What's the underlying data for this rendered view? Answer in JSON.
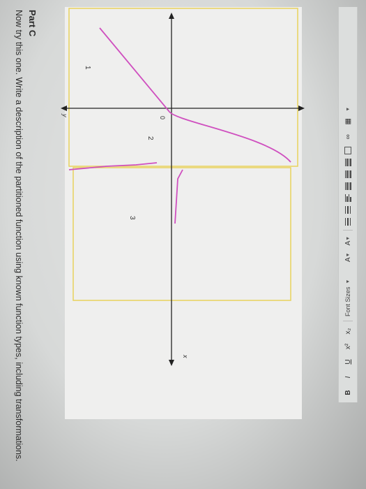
{
  "part": {
    "title": "Part C",
    "instruction": "Now try this one. Write a description of the partitioned function using known function types, including transformations."
  },
  "graph": {
    "axis_labels": {
      "x": "x",
      "y": "y"
    },
    "labels": {
      "region1": "1",
      "region2": "2",
      "region3": "3",
      "origin": "0"
    },
    "colors": {
      "function": "#cf4fbf",
      "axes": "#222222",
      "region_border": "#e8d25c",
      "background": "#efefee"
    }
  },
  "toolbar": {
    "bold": "B",
    "italic": "I",
    "underline": "U",
    "superscript": "x²",
    "subscript": "x₂",
    "font_sizes": "Font Sizes",
    "font_color": "A",
    "highlight": "A"
  }
}
